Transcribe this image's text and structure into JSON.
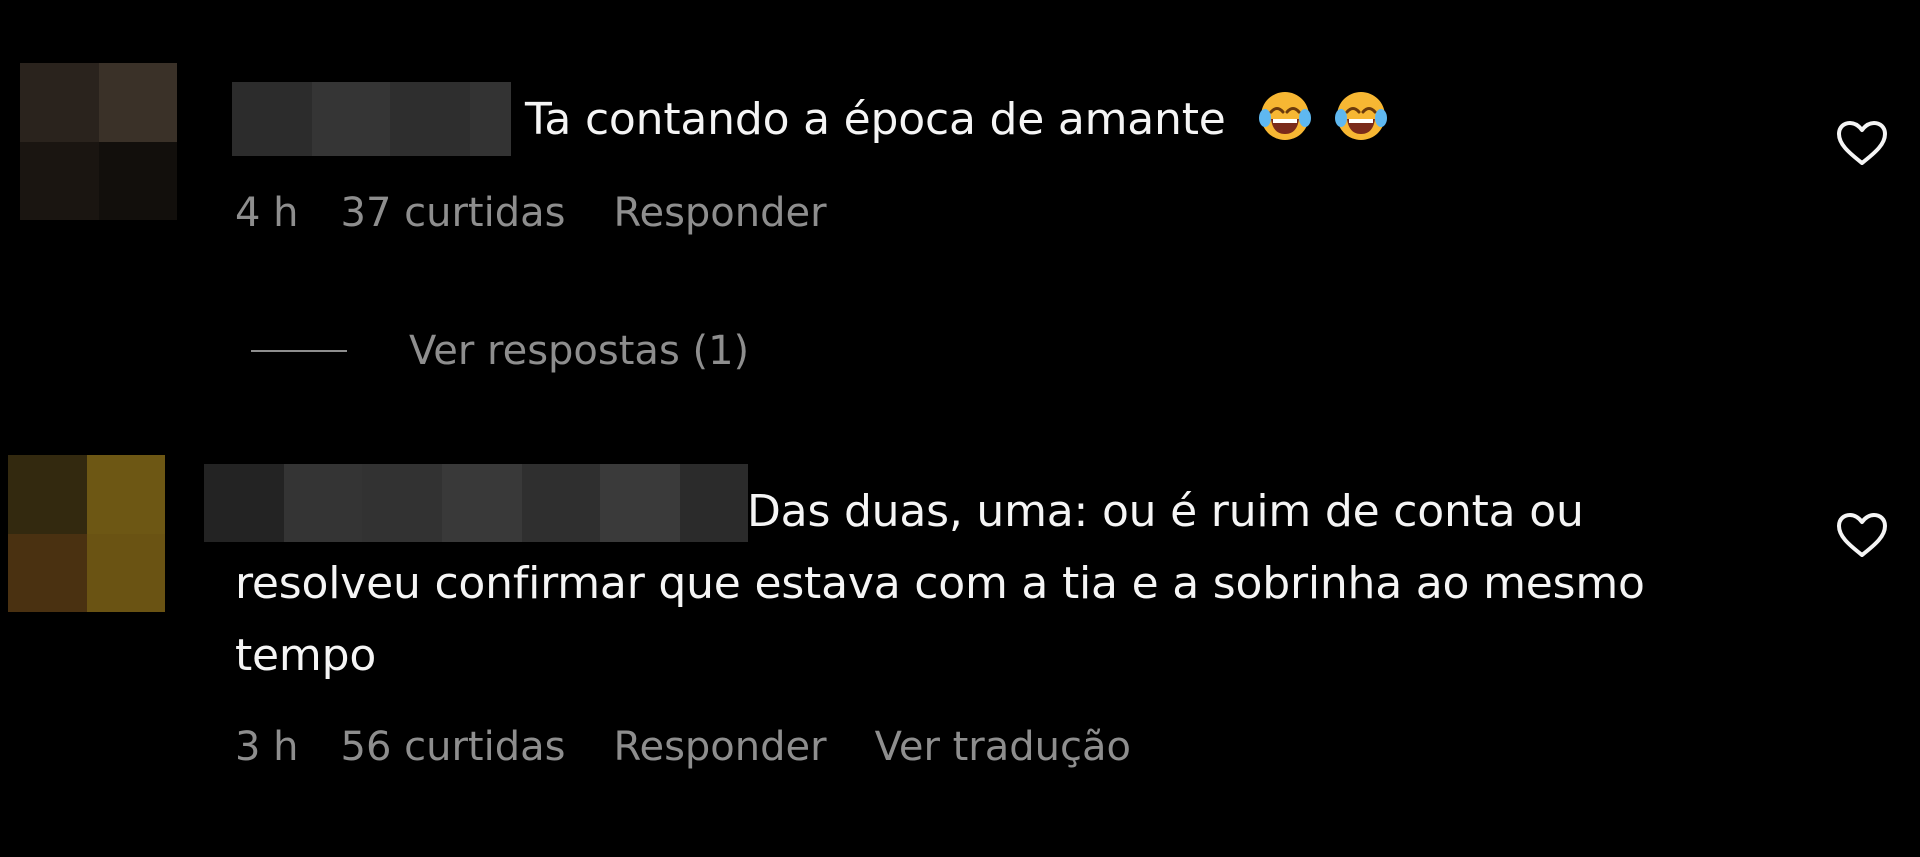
{
  "comments": [
    {
      "text": "Ta contando a época de amante",
      "emojis": [
        "face-with-tears-of-joy-icon",
        "face-with-tears-of-joy-icon"
      ],
      "time": "4 h",
      "likes": "37 curtidas",
      "reply_label": "Responder",
      "replies_label": "Ver respostas (1)",
      "colors": {
        "avatar": [
          "#2a231d",
          "#3a3128",
          "#1a1511",
          "#120f0c"
        ],
        "name_blur": [
          "#2c2c2c",
          "#353535",
          "#2e2e2e",
          "#333333"
        ]
      }
    },
    {
      "text": "Das duas, uma: ou é ruim de conta ou resolveu confirmar que estava com a tia e a sobrinha ao mesmo tempo",
      "time": "3 h",
      "likes": "56 curtidas",
      "reply_label": "Responder",
      "translate_label": "Ver tradução",
      "colors": {
        "avatar": [
          "#33290f",
          "#6d5714",
          "#4a3111",
          "#6a5313"
        ],
        "name_blur": [
          "#232323",
          "#343434",
          "#323232",
          "#393939",
          "#2f2f2f",
          "#3a3a3a",
          "#2b2b2b"
        ]
      }
    }
  ],
  "theme": {
    "background": "#000000",
    "text": "#f5f5f5",
    "muted": "#8e8e8e",
    "heart_stroke": "#f5f5f5"
  },
  "icons": {
    "like": "heart-outline-icon"
  }
}
